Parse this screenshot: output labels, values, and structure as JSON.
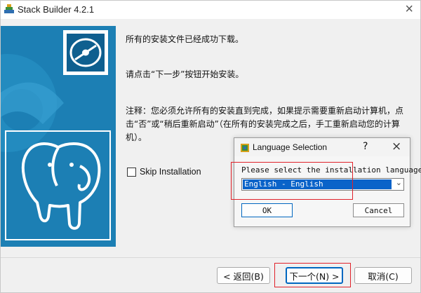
{
  "window": {
    "title": "Stack Builder 4.2.1",
    "close_glyph": "×"
  },
  "main": {
    "line1": "所有的安装文件已经成功下载。",
    "line2": "请点击“下一步”按钮开始安装。",
    "line3": "注释：您必须允许所有的安装直到完成，如果提示需要重新启动计算机，点击“否”或“稍后重新启动”（在所有的安装完成之后，手工重新启动您的计算机）。",
    "skip_label": "Skip Installation"
  },
  "buttons": {
    "back": "< 返回(B)",
    "next": "下一个(N) >",
    "cancel": "取消(C)"
  },
  "dialog": {
    "title": "Language Selection",
    "help_glyph": "?",
    "close_glyph": "×",
    "prompt": "Please select the installation language",
    "selected": "English - English",
    "ok": "OK",
    "cancel": "Cancel"
  },
  "colors": {
    "panel_blue": "#1c7fb4",
    "selection_blue": "#0a63c9",
    "highlight_red": "#e0222a"
  },
  "icons": [
    "stack-builder-app-icon",
    "disc-icon",
    "postgresql-elephant-logo",
    "language-icon",
    "chevron-down-icon"
  ]
}
